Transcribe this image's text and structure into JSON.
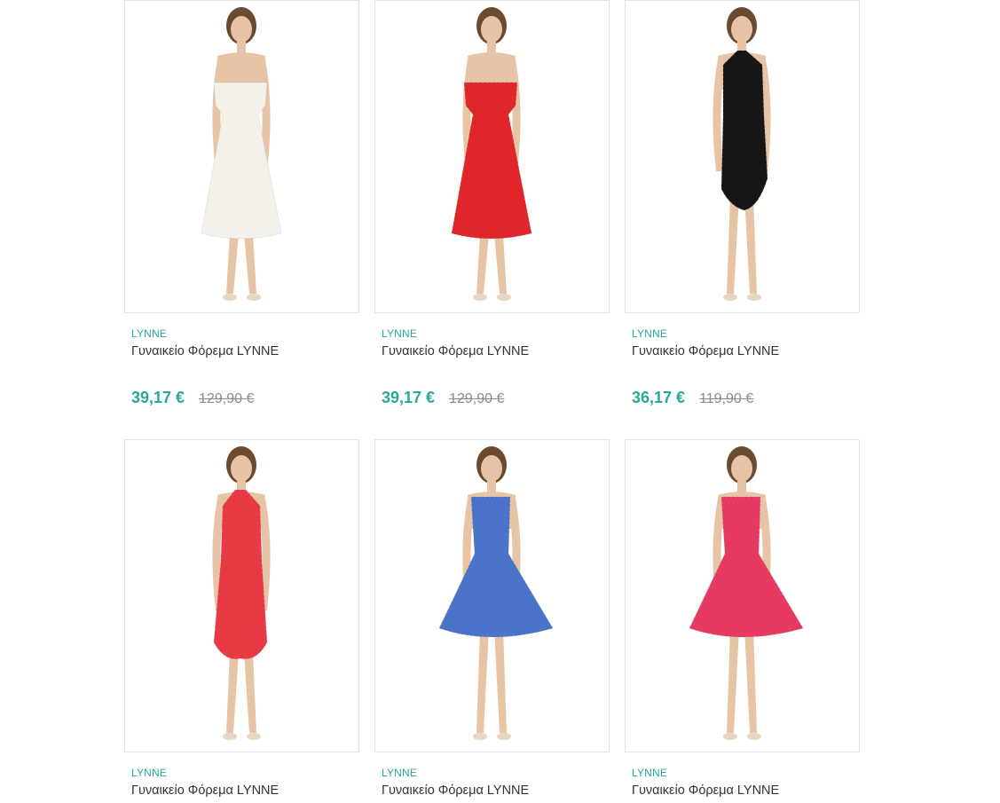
{
  "products": [
    {
      "brand": "LYNNE",
      "title": "Γυναικείο Φόρεμα LYNNE",
      "price": "39,17 €",
      "old_price": "129,90 €",
      "dress_color": "#f4f1ea",
      "style": "offshoulder-midi"
    },
    {
      "brand": "LYNNE",
      "title": "Γυναικείο Φόρεμα LYNNE",
      "price": "39,17 €",
      "old_price": "129,90 €",
      "dress_color": "#e0262a",
      "style": "offshoulder-midi"
    },
    {
      "brand": "LYNNE",
      "title": "Γυναικείο Φόρεμα LYNNE",
      "price": "36,17 €",
      "old_price": "119,90 €",
      "dress_color": "#161616",
      "style": "halter-short"
    },
    {
      "brand": "LYNNE",
      "title": "Γυναικείο Φόρεμα LYNNE",
      "price": "",
      "old_price": "",
      "dress_color": "#e83a44",
      "style": "halter-knee"
    },
    {
      "brand": "LYNNE",
      "title": "Γυναικείο Φόρεμα LYNNE",
      "price": "",
      "old_price": "",
      "dress_color": "#4a73c9",
      "style": "strap-flare"
    },
    {
      "brand": "LYNNE",
      "title": "Γυναικείο Φόρεμα LYNNE",
      "price": "",
      "old_price": "",
      "dress_color": "#e63a63",
      "style": "strap-flare"
    }
  ],
  "colors": {
    "accent": "#27a999",
    "text": "#333333",
    "old_price": "#8a8a8a",
    "border": "#e4e4e4"
  }
}
